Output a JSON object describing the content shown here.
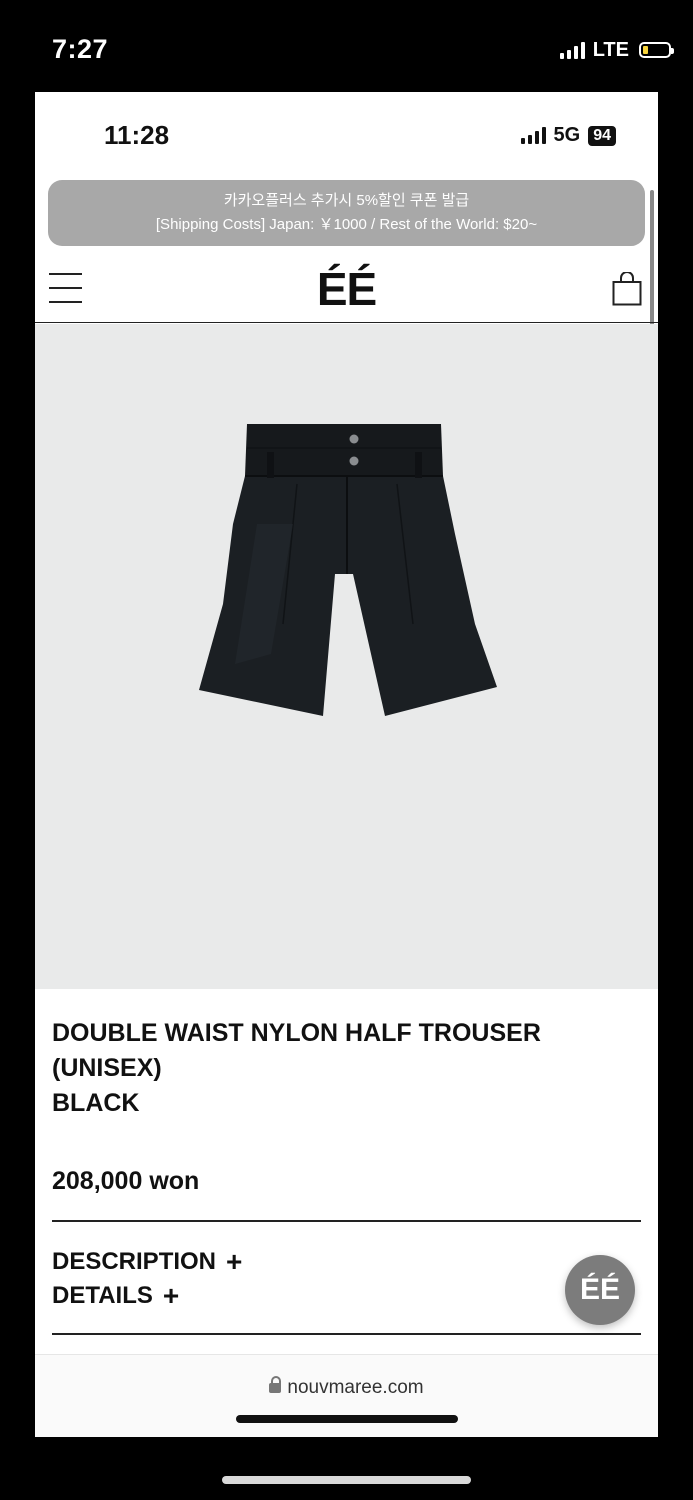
{
  "outer_status": {
    "time": "7:27",
    "network": "LTE",
    "battery_color": "#f6d33b"
  },
  "inner_status": {
    "time": "11:28",
    "network": "5G",
    "battery": "94"
  },
  "banner": {
    "line1": "카카오플러스 추가시 5%할인 쿠폰 발급",
    "line2": "[Shipping Costs] Japan: ￥1000 / Rest of the World: $20~"
  },
  "header": {
    "logo": "ÉÉ",
    "menu_icon": "hamburger-menu-icon",
    "cart_icon": "shopping-bag-icon"
  },
  "product": {
    "image": "black-nylon-half-trouser-photo",
    "title_line1": "DOUBLE WAIST NYLON HALF TROUSER",
    "title_line2": "(UNISEX)",
    "title_line3": "BLACK",
    "price": "208,000 won",
    "description_label": "DESCRIPTION",
    "details_label": "DETAILS",
    "expand_symbol": "+"
  },
  "fab": {
    "label": "ÉÉ"
  },
  "browser": {
    "url": "nouvmaree.com",
    "lock_icon": "lock-icon"
  },
  "colors": {
    "banner_bg": "#a8a8a8",
    "image_bg": "#e9eaea",
    "fab_bg": "#7c7c7c"
  }
}
